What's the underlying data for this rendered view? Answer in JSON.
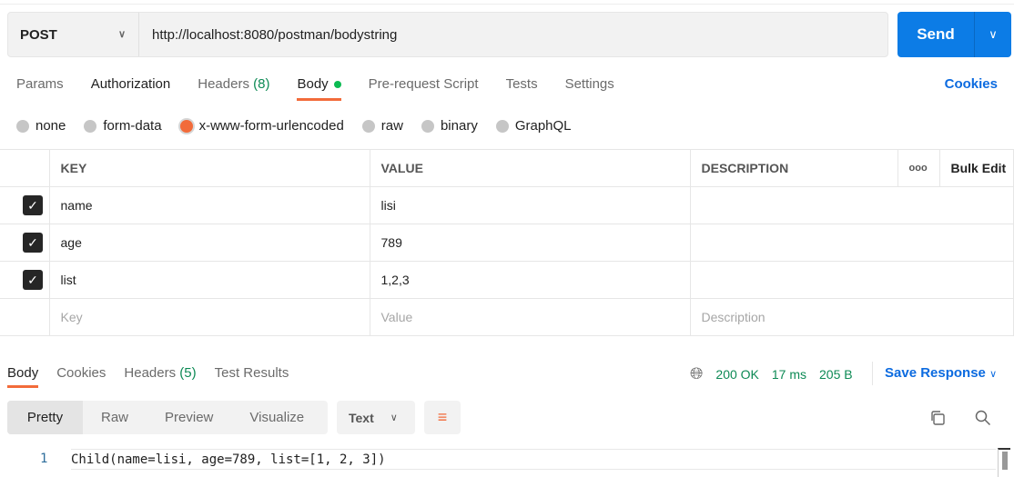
{
  "request": {
    "method": "POST",
    "url": "http://localhost:8080/postman/bodystring",
    "send_label": "Send"
  },
  "tabs": [
    {
      "label": "Params"
    },
    {
      "label": "Authorization"
    },
    {
      "label": "Headers",
      "count": "(8)"
    },
    {
      "label": "Body"
    },
    {
      "label": "Pre-request Script"
    },
    {
      "label": "Tests"
    },
    {
      "label": "Settings"
    }
  ],
  "cookies_label": "Cookies",
  "body_types": [
    "none",
    "form-data",
    "x-www-form-urlencoded",
    "raw",
    "binary",
    "GraphQL"
  ],
  "selected_body_type": "x-www-form-urlencoded",
  "table": {
    "headers": [
      "KEY",
      "VALUE",
      "DESCRIPTION"
    ],
    "more": "ooo",
    "bulk_edit": "Bulk Edit",
    "rows": [
      {
        "key": "name",
        "value": "lisi",
        "checked": true
      },
      {
        "key": "age",
        "value": "789",
        "checked": true
      },
      {
        "key": "list",
        "value": "1,2,3",
        "checked": true
      }
    ],
    "placeholders": {
      "key": "Key",
      "value": "Value",
      "description": "Description"
    }
  },
  "response": {
    "tabs": [
      {
        "label": "Body"
      },
      {
        "label": "Cookies"
      },
      {
        "label": "Headers",
        "count": "(5)"
      },
      {
        "label": "Test Results"
      }
    ],
    "status": "200 OK",
    "time": "17 ms",
    "size": "205 B",
    "save_label": "Save Response",
    "formats": [
      "Pretty",
      "Raw",
      "Preview",
      "Visualize"
    ],
    "type": "Text",
    "line_number": "1",
    "code": "Child(name=lisi, age=789, list=[1, 2, 3])"
  },
  "colors": {
    "accent": "#f26b3a",
    "primary": "#0c7ce6",
    "success": "#0d8a55"
  }
}
